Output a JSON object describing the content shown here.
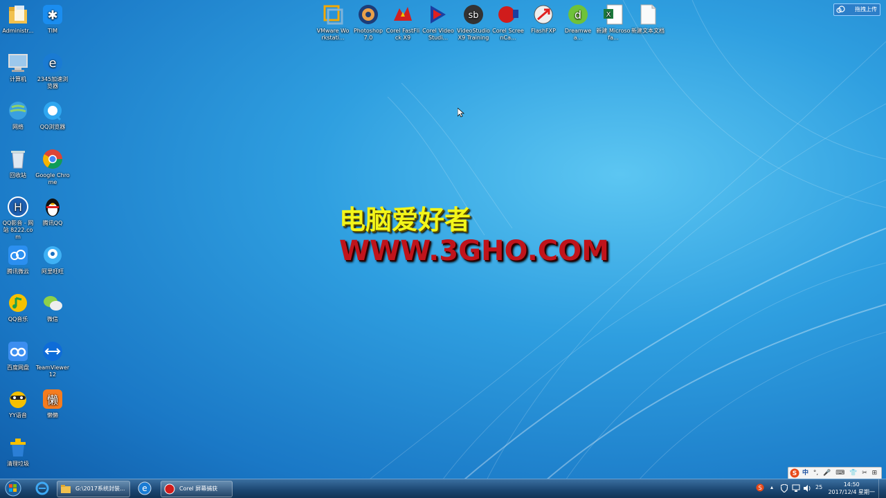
{
  "desktop": {
    "left_icons": [
      {
        "label": "Administr...",
        "icon": "folder-icon"
      },
      {
        "label": "TIM",
        "icon": "tim-icon"
      },
      {
        "label": "计算机",
        "icon": "computer-icon"
      },
      {
        "label": "2345加速浏览器",
        "icon": "browser-e-icon"
      },
      {
        "label": "网络",
        "icon": "network-icon"
      },
      {
        "label": "QQ浏览器",
        "icon": "qq-browser-icon"
      },
      {
        "label": "回收站",
        "icon": "recycle-bin-icon"
      },
      {
        "label": "Google Chrome",
        "icon": "chrome-icon"
      },
      {
        "label": "QQ影音 - 网站 8222.com",
        "icon": "h-site-icon"
      },
      {
        "label": "腾讯QQ",
        "icon": "qq-penguin-icon"
      },
      {
        "label": "腾讯微云",
        "icon": "weiyun-icon"
      },
      {
        "label": "阿里旺旺",
        "icon": "aliwangwang-icon"
      },
      {
        "label": "QQ音乐",
        "icon": "qq-music-icon"
      },
      {
        "label": "微信",
        "icon": "wechat-icon"
      },
      {
        "label": "百度网盘",
        "icon": "baidu-netdisk-icon"
      },
      {
        "label": "TeamViewer 12",
        "icon": "teamviewer-icon"
      },
      {
        "label": "YY语音",
        "icon": "yy-icon"
      },
      {
        "label": "懒懒",
        "icon": "lan-icon"
      },
      {
        "label": "清理垃圾",
        "icon": "trash-clean-icon"
      }
    ],
    "top_icons": [
      {
        "label": "VMware Workstati...",
        "icon": "vmware-icon"
      },
      {
        "label": "Photoshop 7.0",
        "icon": "photoshop-icon"
      },
      {
        "label": "Corel FastFlick X9",
        "icon": "fastflick-icon"
      },
      {
        "label": "Corel VideoStudi...",
        "icon": "videostudio-icon"
      },
      {
        "label": "VideoStudio X9 Training",
        "icon": "sb-icon"
      },
      {
        "label": "Corel ScreenCa...",
        "icon": "screencap-icon"
      },
      {
        "label": "FlashFXP",
        "icon": "flashfxp-icon"
      },
      {
        "label": "Dreamwea...",
        "icon": "dreamweaver-icon"
      },
      {
        "label": "新建 Microsofa...",
        "icon": "excel-icon"
      },
      {
        "label": "新建文本文档",
        "icon": "text-doc-icon"
      }
    ],
    "upload_button": "拖拽上传",
    "overlay_title": "电脑爱好者",
    "overlay_url": "WWW.3GHO.COM"
  },
  "ime": {
    "label": "中",
    "items": [
      "°,",
      "🎤",
      "⌨",
      "👕",
      "✂",
      "⊞"
    ]
  },
  "taskbar": {
    "buttons": [
      {
        "label": "G:\\2017系统封装...",
        "icon": "folder-icon"
      },
      {
        "label": "Corel 屏幕捕获",
        "icon": "record-icon"
      }
    ],
    "tray_num": "25",
    "clock_time": "14:50",
    "clock_date": "2017/12/4 星期一"
  },
  "colors": {
    "title_yellow": "#f3f51a",
    "url_red": "#c0141b",
    "desktop_blue": "#2f9fe0"
  }
}
